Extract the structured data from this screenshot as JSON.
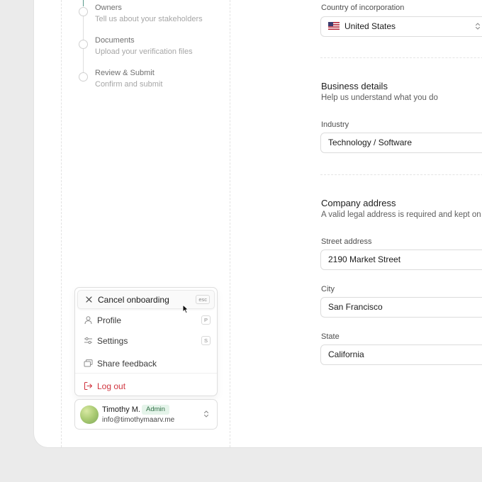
{
  "steps": [
    {
      "title": "Owners",
      "subtitle": "Tell us about your stakeholders"
    },
    {
      "title": "Documents",
      "subtitle": "Upload your verification files"
    },
    {
      "title": "Review & Submit",
      "subtitle": "Confirm and submit"
    }
  ],
  "form": {
    "country": {
      "label": "Country of incorporation",
      "value": "United States",
      "flag_icon": "us-flag-icon"
    },
    "business": {
      "title": "Business details",
      "subtitle": "Help us understand what you do",
      "industry_label": "Industry",
      "industry_value": "Technology / Software"
    },
    "address": {
      "title": "Company address",
      "subtitle": "A valid legal address is required and kept on fil",
      "street_label": "Street address",
      "street_value": "2190 Market Street",
      "city_label": "City",
      "city_value": "San Francisco",
      "state_label": "State",
      "state_value": "California"
    }
  },
  "menu": {
    "items": [
      {
        "label": "Cancel onboarding",
        "shortcut": "esc",
        "icon": "close-icon"
      },
      {
        "label": "Profile",
        "shortcut": "P",
        "icon": "user-icon"
      },
      {
        "label": "Settings",
        "shortcut": "S",
        "icon": "sliders-icon"
      },
      {
        "label": "Share feedback",
        "icon": "chat-icon"
      },
      {
        "label": "Log out",
        "icon": "logout-icon"
      }
    ]
  },
  "user": {
    "name": "Timothy M.",
    "role": "Admin",
    "email": "info@timothymaarv.me"
  },
  "colors": {
    "danger": "#d0353f",
    "badge_bg": "#e5f4ea",
    "badge_text": "#2f6f46",
    "step_active": "#5a9a8c"
  }
}
